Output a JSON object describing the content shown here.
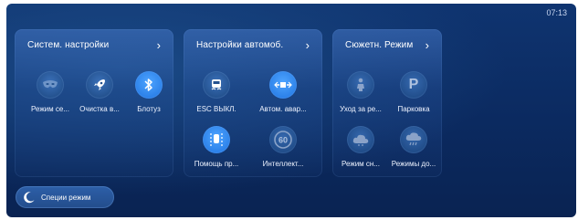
{
  "status_bar": {
    "time": "07:13"
  },
  "cards": [
    {
      "title": "Систем. настройки",
      "items": [
        {
          "label": "Режим се...",
          "icon": "eye-mask-icon"
        },
        {
          "label": "Очистка в...",
          "icon": "rocket-icon"
        },
        {
          "label": "Блотуз",
          "icon": "bluetooth-icon"
        }
      ]
    },
    {
      "title": "Настройки автомоб.",
      "items": [
        {
          "label": "ESC ВЫКЛ.",
          "icon": "esc-off-icon"
        },
        {
          "label": "Автом. авар...",
          "icon": "auto-hazard-icon"
        },
        {
          "label": "Помощь пр...",
          "icon": "lane-assist-icon"
        },
        {
          "label": "Интеллект...",
          "icon": "speed-limit-icon",
          "icon_text": "60"
        }
      ]
    },
    {
      "title": "Сюжетн. Режим",
      "items": [
        {
          "label": "Уход за ре...",
          "icon": "child-care-icon"
        },
        {
          "label": "Парковка",
          "icon": "parking-icon",
          "icon_text": "P"
        },
        {
          "label": "Режим сн...",
          "icon": "sleep-cloud-icon"
        },
        {
          "label": "Режимы до...",
          "icon": "rain-cloud-icon"
        }
      ]
    }
  ],
  "special_mode": {
    "label": "Специи режим",
    "icon": "moon-icon"
  },
  "colors": {
    "accent": "#2a7fe8",
    "background": "#0b2a60"
  }
}
